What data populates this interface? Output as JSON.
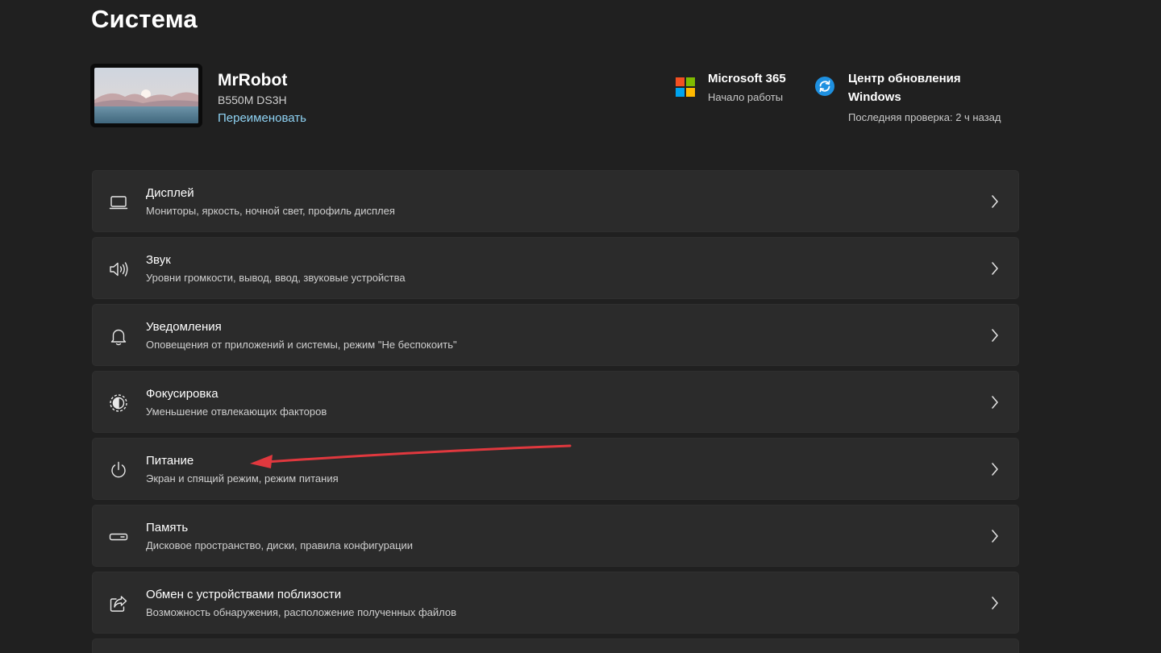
{
  "page": {
    "title": "Система"
  },
  "device": {
    "name": "MrRobot",
    "model": "B550M DS3H",
    "rename_label": "Переименовать"
  },
  "quick_links": [
    {
      "title": "Microsoft 365",
      "subtitle": "Начало работы",
      "icon": "microsoft-logo-icon"
    },
    {
      "title": "Центр обновления Windows",
      "subtitle": "Последняя проверка: 2 ч назад",
      "icon": "windows-update-icon"
    }
  ],
  "settings": [
    {
      "title": "Дисплей",
      "subtitle": "Мониторы, яркость, ночной свет, профиль дисплея",
      "icon": "display-icon"
    },
    {
      "title": "Звук",
      "subtitle": "Уровни громкости, вывод, ввод, звуковые устройства",
      "icon": "sound-icon"
    },
    {
      "title": "Уведомления",
      "subtitle": "Оповещения от приложений и системы, режим \"Не беспокоить\"",
      "icon": "bell-icon"
    },
    {
      "title": "Фокусировка",
      "subtitle": "Уменьшение отвлекающих факторов",
      "icon": "focus-icon"
    },
    {
      "title": "Питание",
      "subtitle": "Экран и спящий режим, режим питания",
      "icon": "power-icon"
    },
    {
      "title": "Память",
      "subtitle": "Дисковое пространство, диски, правила конфигурации",
      "icon": "storage-icon"
    },
    {
      "title": "Обмен с устройствами поблизости",
      "subtitle": "Возможность обнаружения, расположение полученных файлов",
      "icon": "share-icon"
    }
  ],
  "colors": {
    "background": "#202020",
    "card": "#2b2b2b",
    "link": "#8fd3f4",
    "annotation_arrow": "#e0383e",
    "ms_red": "#f25022",
    "ms_green": "#7fba00",
    "ms_blue": "#00a4ef",
    "ms_yellow": "#ffb900",
    "update_blue": "#1e90e0"
  }
}
